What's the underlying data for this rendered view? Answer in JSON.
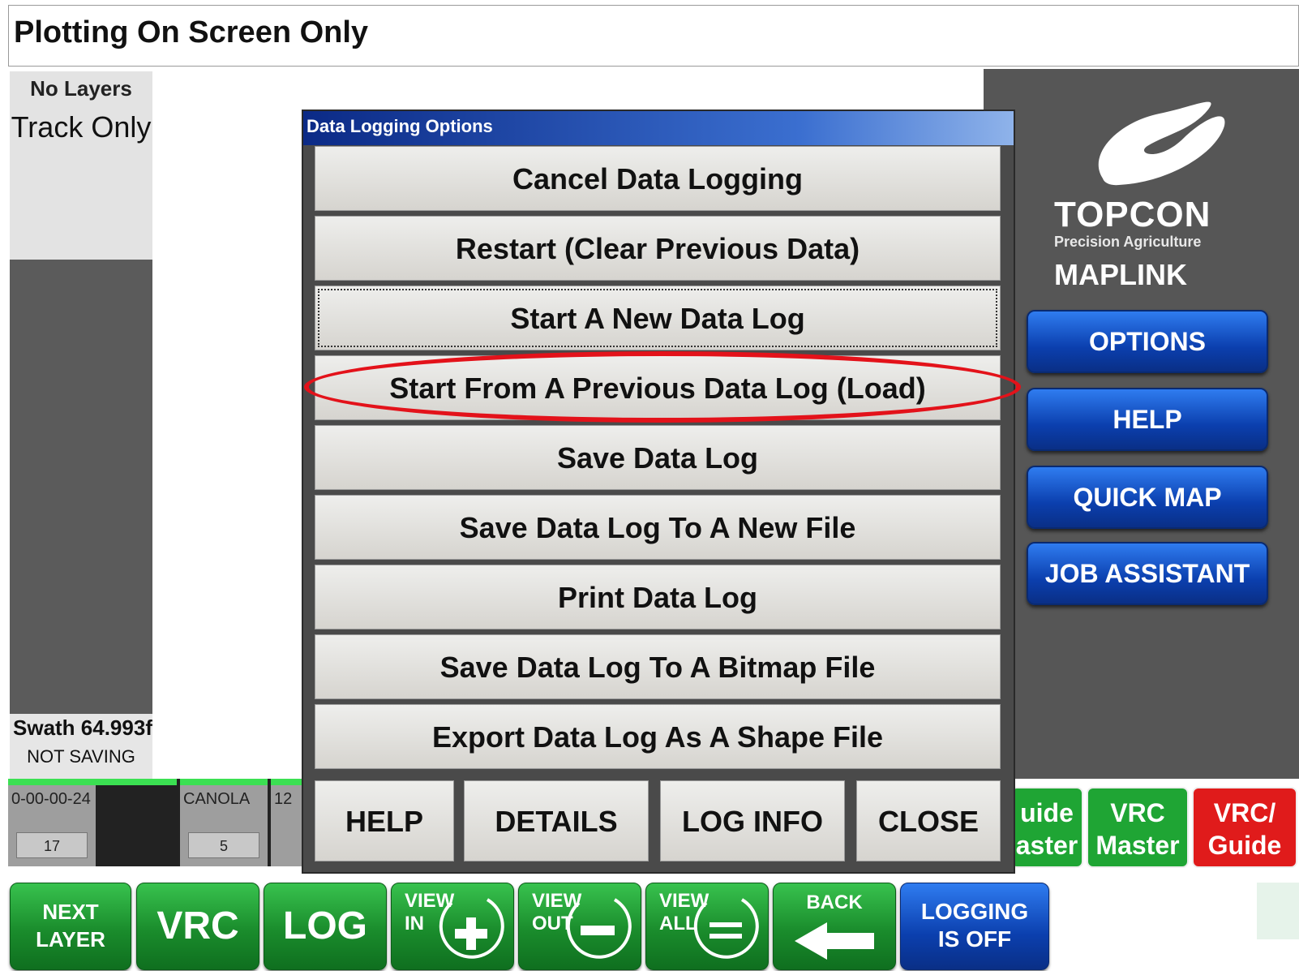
{
  "title": "Plotting On Screen Only",
  "left_panel": {
    "layers": "No Layers",
    "track": "Track Only",
    "swath": "Swath 64.993f",
    "saving": "NOT SAVING"
  },
  "brand": {
    "name": "TOPCON",
    "sub": "Precision Agriculture",
    "product": "MAPLINK"
  },
  "right_menu": [
    "OPTIONS",
    "HELP",
    "QUICK MAP",
    "JOB ASSISTANT"
  ],
  "dialog": {
    "title": "Data Logging Options",
    "options": [
      "Cancel Data Logging",
      "Restart (Clear Previous Data)",
      "Start A New Data Log",
      "Start From A Previous Data Log (Load)",
      "Save Data Log",
      "Save Data Log To A New File",
      "Print Data Log",
      "Save Data Log To A Bitmap File",
      "Export Data Log As A Shape File"
    ],
    "bottom_buttons": [
      "HELP",
      "DETAILS",
      "LOG INFO",
      "CLOSE"
    ]
  },
  "layer_strip": [
    {
      "label": "0-00-00-24",
      "num": "17"
    },
    {
      "label": "",
      "num": ""
    },
    {
      "label": "CANOLA",
      "num": "5"
    },
    {
      "label": "12",
      "num": ""
    }
  ],
  "guide_buttons": [
    {
      "line1": "uide",
      "line2": "aster",
      "color": "#1fa534"
    },
    {
      "line1": "VRC",
      "line2": "Master",
      "color": "#1fa534"
    },
    {
      "line1": "VRC/",
      "line2": "Guide",
      "color": "#e01b1b"
    }
  ],
  "toolbar": {
    "next_layer_1": "NEXT",
    "next_layer_2": "LAYER",
    "vrc": "VRC",
    "log": "LOG",
    "view_in_1": "VIEW",
    "view_in_2": "IN",
    "view_out_1": "VIEW",
    "view_out_2": "OUT",
    "view_all_1": "VIEW",
    "view_all_2": "ALL",
    "back": "BACK",
    "logging_1": "LOGGING",
    "logging_2": "IS OFF"
  }
}
